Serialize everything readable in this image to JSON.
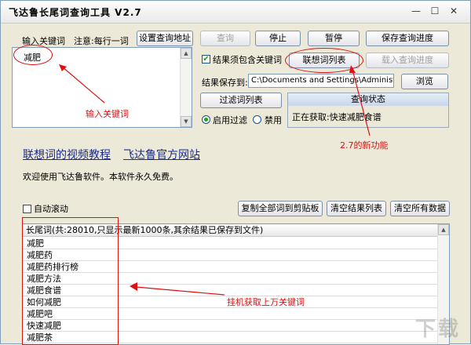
{
  "window": {
    "title": "飞达鲁长尾词查询工具  V2.7",
    "min_glyph": "—",
    "max_glyph": "☐",
    "close_glyph": "✕"
  },
  "input": {
    "label": "输入关键词",
    "hint": "注意:每行一词",
    "value": "减肥"
  },
  "toolbar": {
    "set_address": "设置查询地址",
    "query": "查询",
    "stop": "停止",
    "pause": "暂停",
    "save_progress": "保存查询进度",
    "suggest_list": "联想词列表",
    "load_progress": "载入查询进度"
  },
  "options": {
    "must_contain_label": "结果须包含关键词",
    "must_contain_checked": true,
    "save_to_label": "结果保存到:",
    "save_path": "C:\\Documents and Settings\\Administrator\\桌",
    "browse": "浏览",
    "filter_list": "过滤词列表",
    "filter_on": "启用过滤",
    "filter_off": "禁用",
    "filter_enabled": true
  },
  "status": {
    "header": "查询状态",
    "text": "正在获取:快速减肥食谱"
  },
  "annotations": {
    "input_keyword": "输入关键词",
    "new_feature": "2.7的新功能",
    "auto_fetch": "挂机获取上万关键词"
  },
  "links": {
    "tutorial": "联想词的视频教程",
    "official": "飞达鲁官方网站"
  },
  "welcome": "欢迎使用飞达鲁软件。本软件永久免费。",
  "results": {
    "auto_scroll_label": "自动滚动",
    "auto_scroll_checked": false,
    "copy_all": "复制全部词到剪贴板",
    "clear_results": "清空结果列表",
    "clear_all": "清空所有数据",
    "column_header": "长尾词(共:28010,只显示最新1000条,其余结果已保存到文件)",
    "rows": [
      "减肥",
      "减肥药",
      "减肥药排行榜",
      "减肥方法",
      "减肥食谱",
      "如何减肥",
      "减肥吧",
      "快速减肥",
      "减肥茶"
    ]
  },
  "watermark": "下载"
}
